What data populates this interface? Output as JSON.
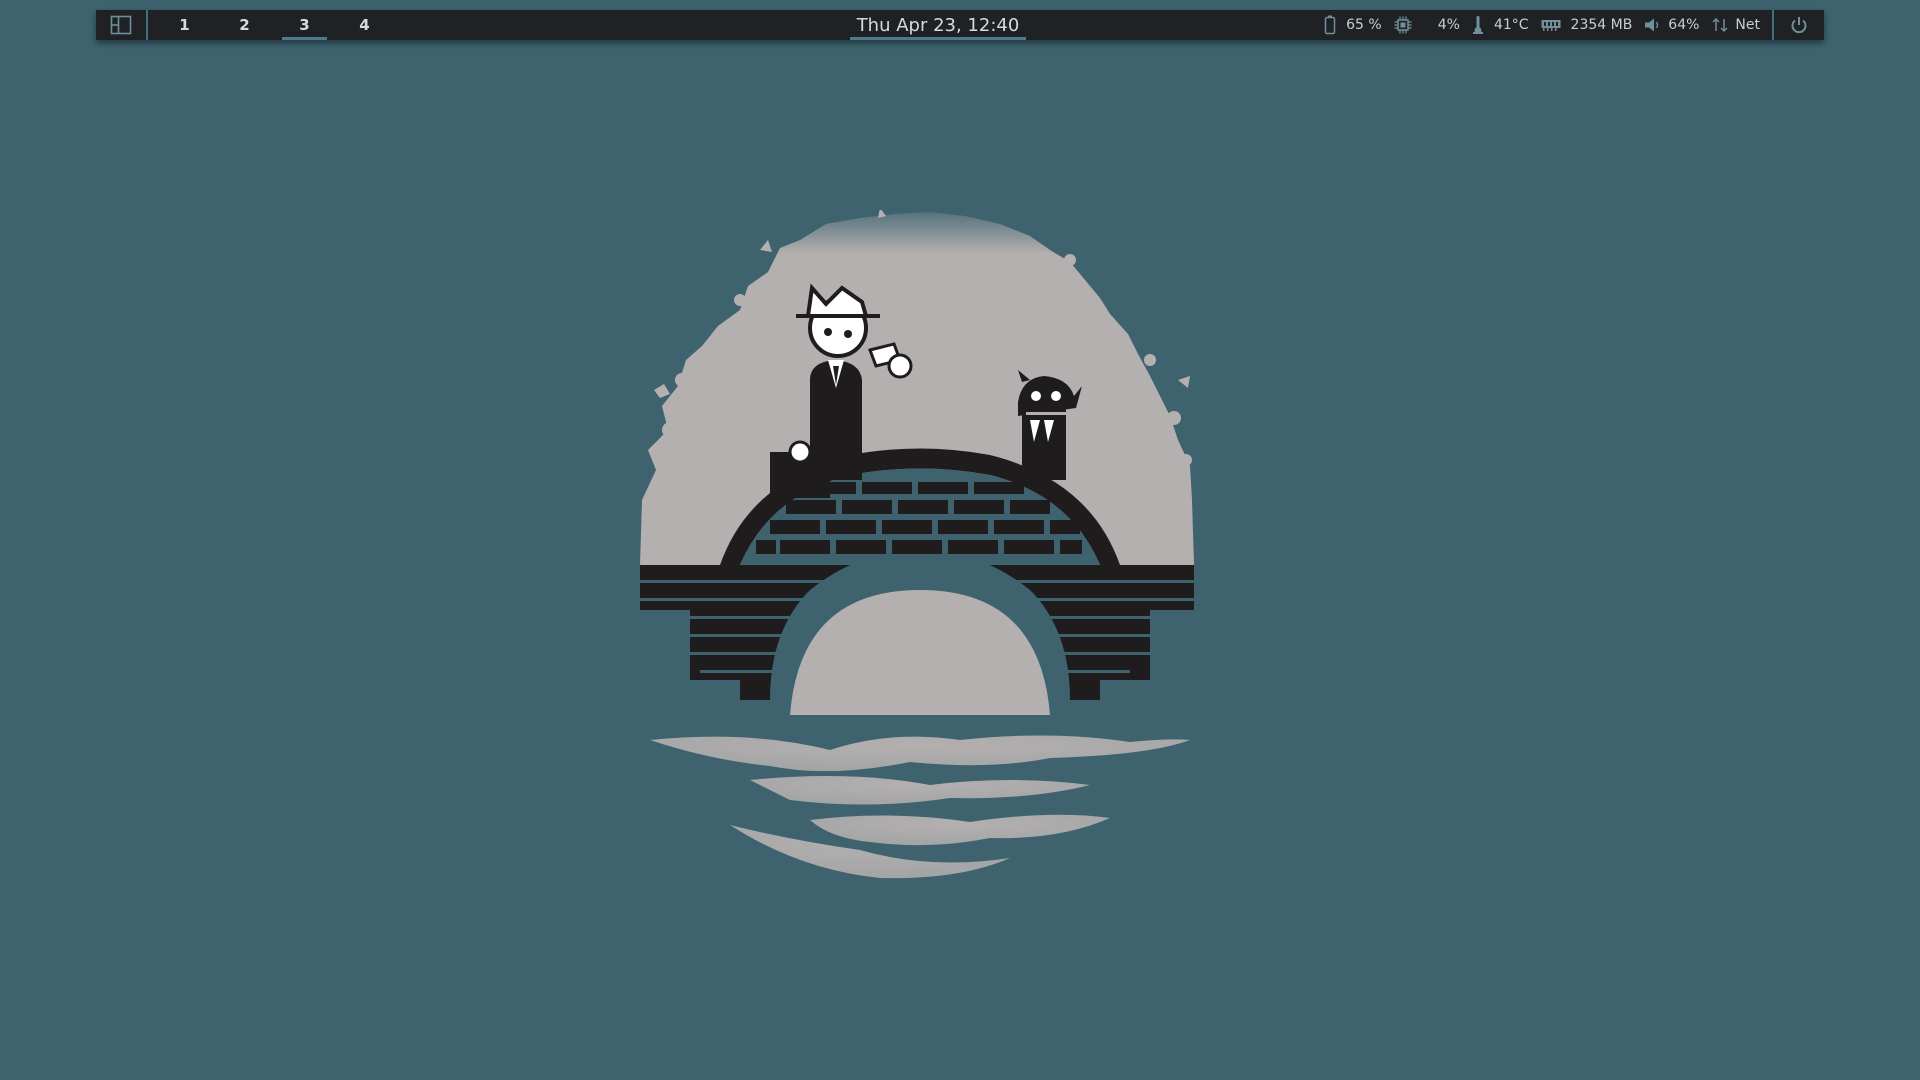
{
  "topbar": {
    "layout_icon": "layout-icon",
    "workspaces": [
      {
        "label": "1",
        "active": false
      },
      {
        "label": "2",
        "active": false
      },
      {
        "label": "3",
        "active": true
      },
      {
        "label": "4",
        "active": false
      }
    ],
    "clock": "Thu Apr 23, 12:40",
    "modules": {
      "battery": {
        "icon": "battery-icon",
        "value": "65 %"
      },
      "cpu": {
        "icon": "cpu-icon",
        "value": "4%"
      },
      "temperature": {
        "icon": "thermometer-icon",
        "value": "41°C"
      },
      "memory": {
        "icon": "memory-icon",
        "value": "2354 MB"
      },
      "volume": {
        "icon": "volume-icon",
        "value": "64%"
      },
      "network": {
        "icon": "network-arrows-icon",
        "value": "Net"
      }
    },
    "power_icon": "power-icon"
  },
  "colors": {
    "desktop_bg": "#3e636f",
    "bar_bg": "#1f2124",
    "accent": "#4c7c8b",
    "bar_text": "#c9ced1",
    "art_light": "#b5b0b0",
    "art_dark": "#1f1c1d"
  },
  "wallpaper": {
    "description_icon": "spy-vs-android-bridge-wallpaper"
  }
}
